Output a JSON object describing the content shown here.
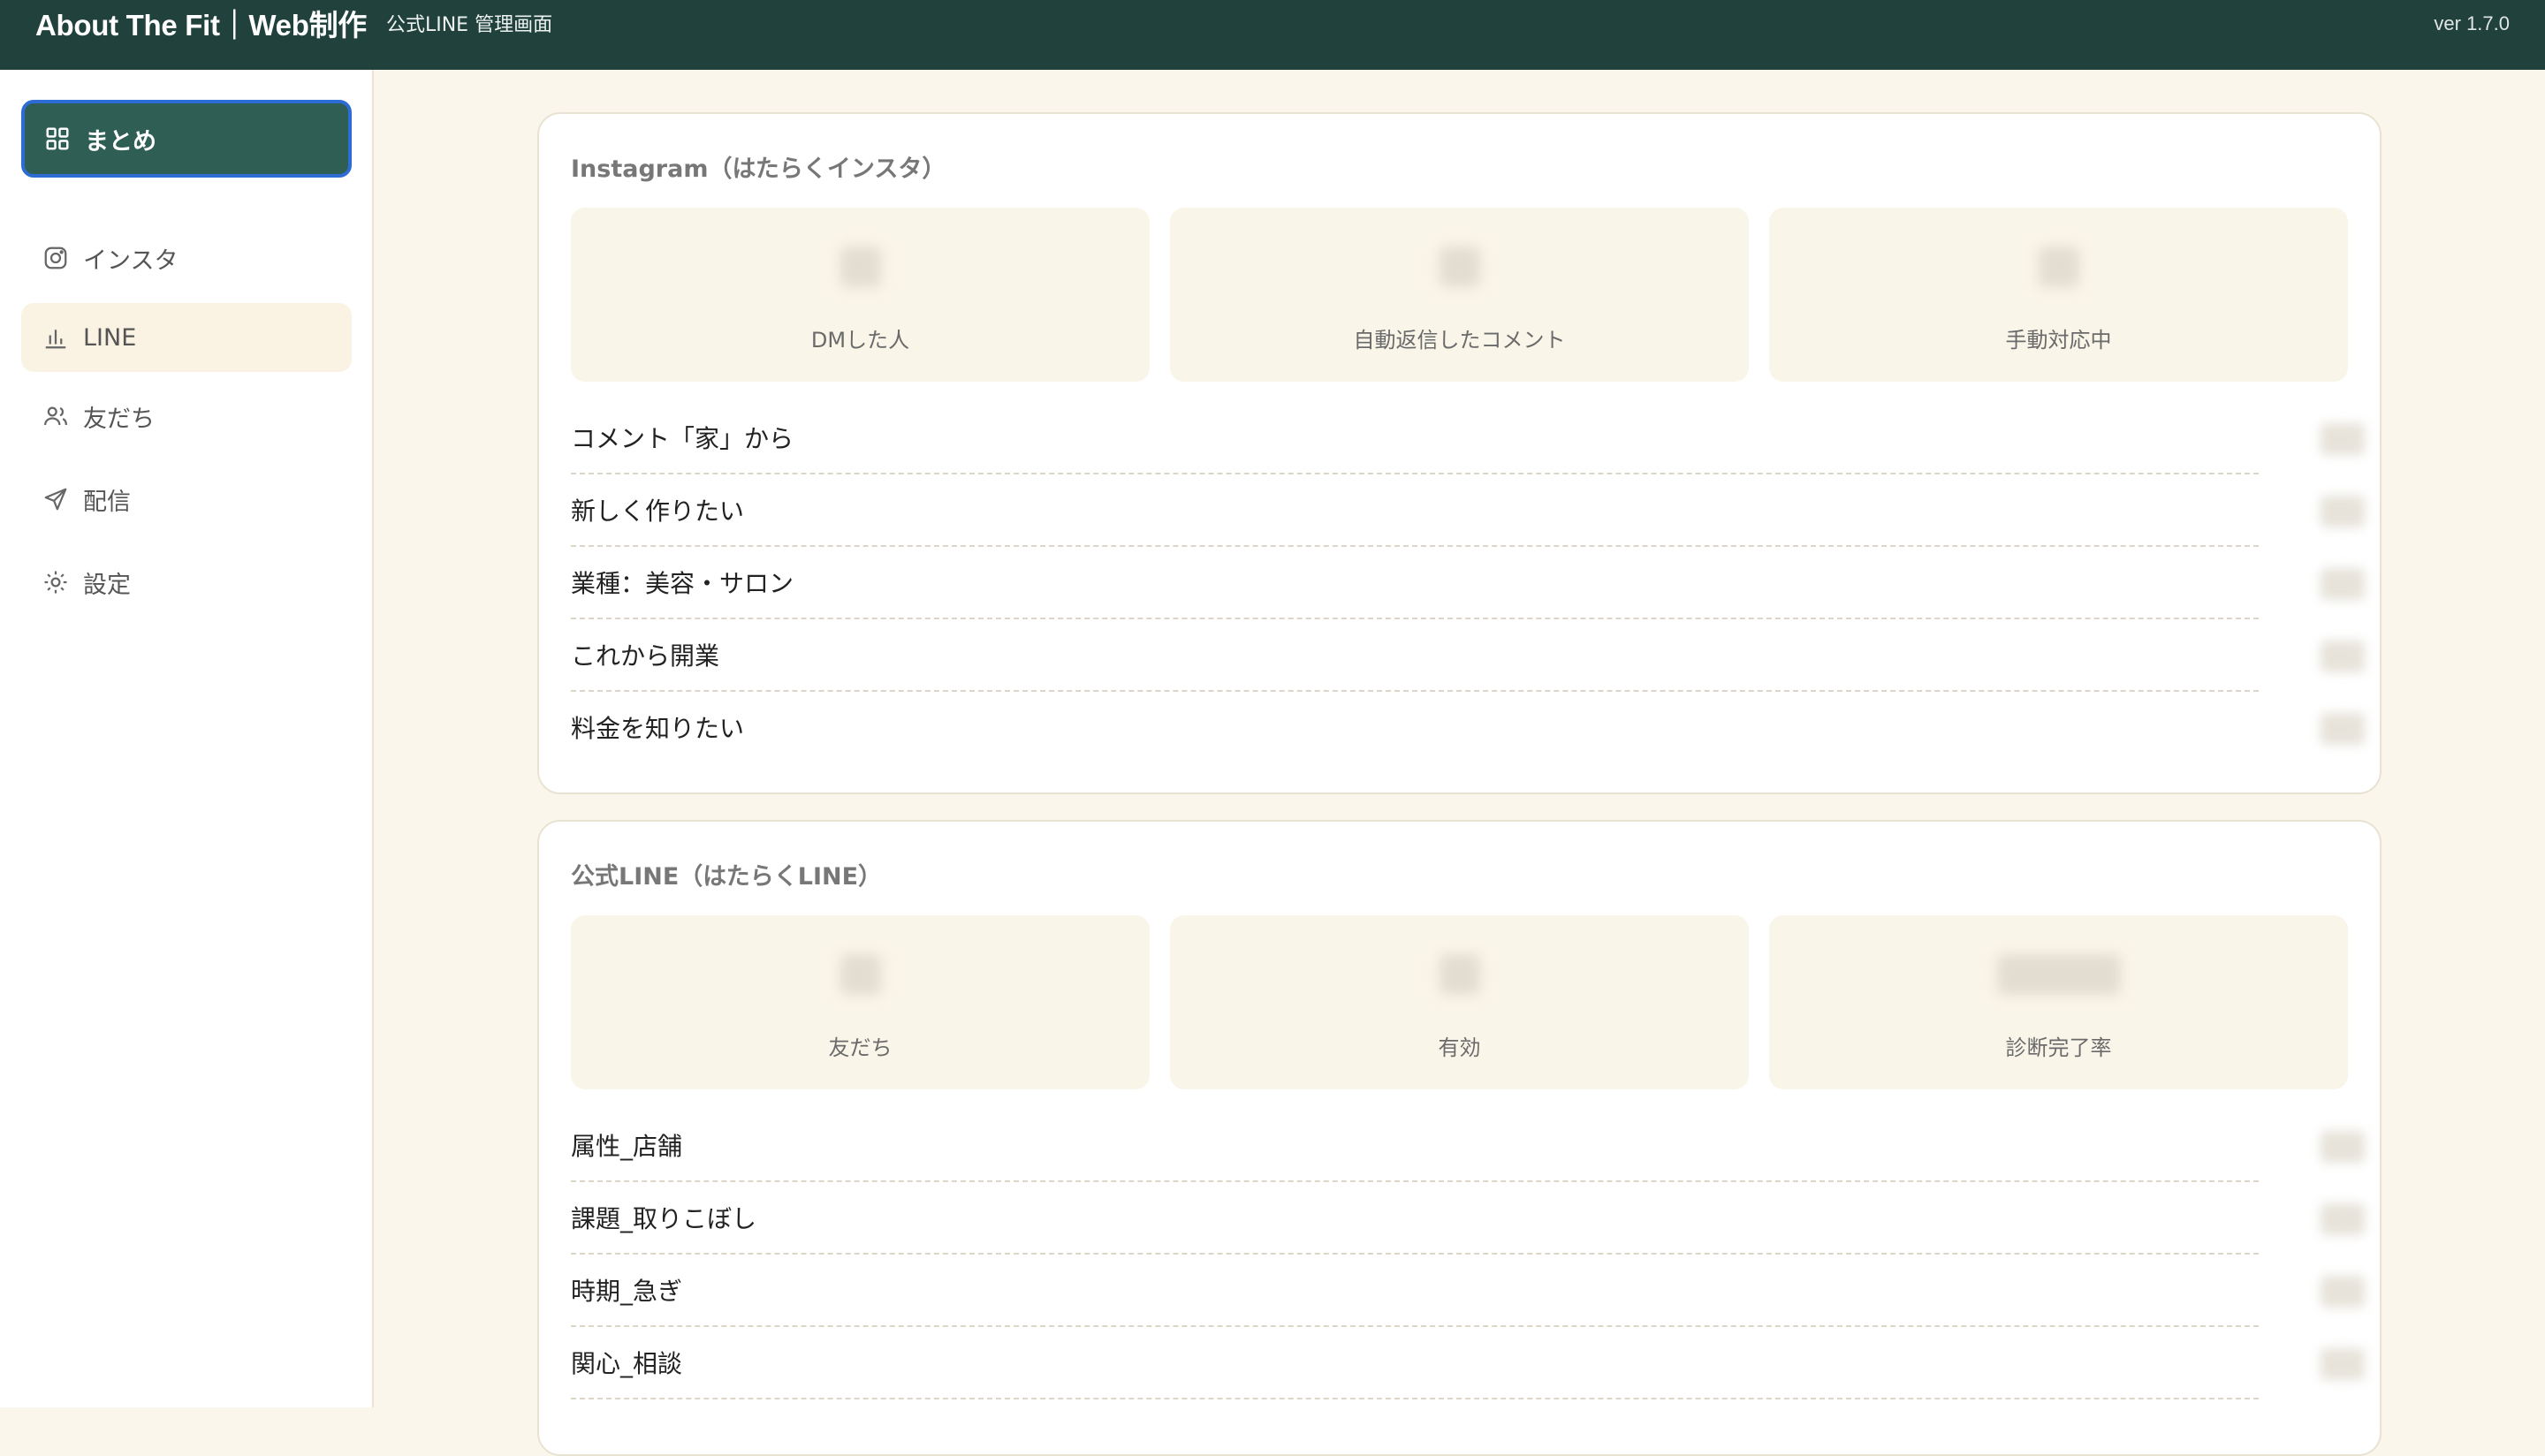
{
  "header": {
    "brand_title": "About The Fit｜Web制作",
    "brand_subtitle": "公式LINE 管理画面",
    "version": "ver 1.7.0"
  },
  "sidebar": {
    "items": [
      {
        "label": "まとめ",
        "icon": "grid-icon",
        "state": "active"
      },
      {
        "label": "インスタ",
        "icon": "instagram-icon",
        "state": "normal"
      },
      {
        "label": "LINE",
        "icon": "bar-chart-icon",
        "state": "hover"
      },
      {
        "label": "友だち",
        "icon": "users-icon",
        "state": "normal"
      },
      {
        "label": "配信",
        "icon": "send-icon",
        "state": "normal"
      },
      {
        "label": "設定",
        "icon": "gear-icon",
        "state": "normal"
      }
    ]
  },
  "instagram": {
    "title": "Instagram（はたらくインスタ）",
    "stats": [
      {
        "label": "DMした人"
      },
      {
        "label": "自動返信したコメント"
      },
      {
        "label": "手動対応中"
      }
    ],
    "rows": [
      {
        "label": "コメント「家」から"
      },
      {
        "label": "新しく作りたい"
      },
      {
        "label": "業種：美容・サロン"
      },
      {
        "label": "これから開業"
      },
      {
        "label": "料金を知りたい"
      }
    ]
  },
  "line": {
    "title": "公式LINE（はたらくLINE）",
    "stats": [
      {
        "label": "友だち"
      },
      {
        "label": "有効"
      },
      {
        "label": "診断完了率"
      }
    ],
    "rows": [
      {
        "label": "属性_店舗"
      },
      {
        "label": "課題_取りこぼし"
      },
      {
        "label": "時期_急ぎ"
      },
      {
        "label": "関心_相談"
      }
    ]
  },
  "colors": {
    "header_bg": "#21413d",
    "active_nav_bg": "#2f5e54",
    "active_nav_border": "#2d6cd4",
    "page_bg": "#faf6eb",
    "stat_bg": "#faf5e9"
  }
}
